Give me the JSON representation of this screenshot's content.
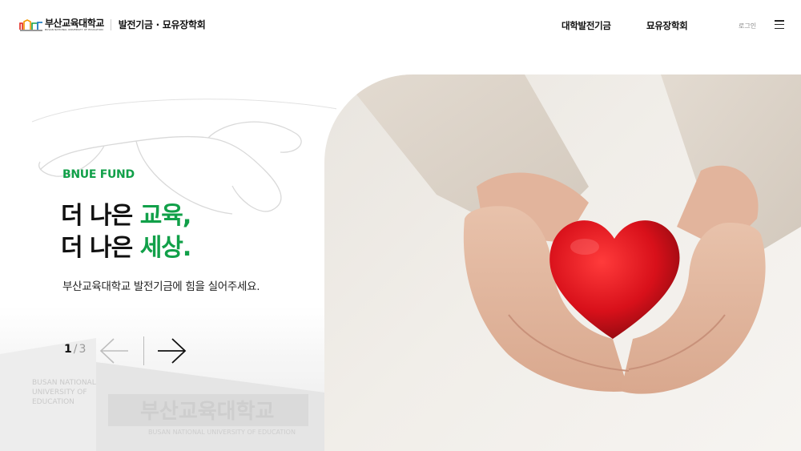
{
  "header": {
    "logo_name": "부산교육대학교",
    "logo_sub": "BUSAN NATIONAL UNIVERSITY OF EDUCATION",
    "site_name": "발전기금 · 묘유장학회",
    "nav": [
      "대학발전기금",
      "묘유장학회"
    ],
    "login": "로그인",
    "menu_icon": "hamburger-icon"
  },
  "hero": {
    "eyebrow": "BNUE FUND",
    "line1_plain": "더 나은 ",
    "line1_accent": "교육,",
    "line2_plain": "더 나은 ",
    "line2_accent": "세상.",
    "subline": "부산교육대학교 발전기금에 힘을 실어주세요.",
    "pager": {
      "current": "1",
      "separator": "/",
      "total": "3"
    },
    "prev_icon": "arrow-left-icon",
    "next_icon": "arrow-right-icon",
    "building_text_1": "BUSAN NATIONAL",
    "building_text_2": "UNIVERSITY OF",
    "building_text_3": "EDUCATION",
    "building_text_4": "부산교육대학교",
    "building_text_5": "BUSAN NATIONAL UNIVERSITY OF EDUCATION"
  },
  "colors": {
    "accent": "#11a049",
    "heart": "#d8101a",
    "text": "#111111"
  }
}
